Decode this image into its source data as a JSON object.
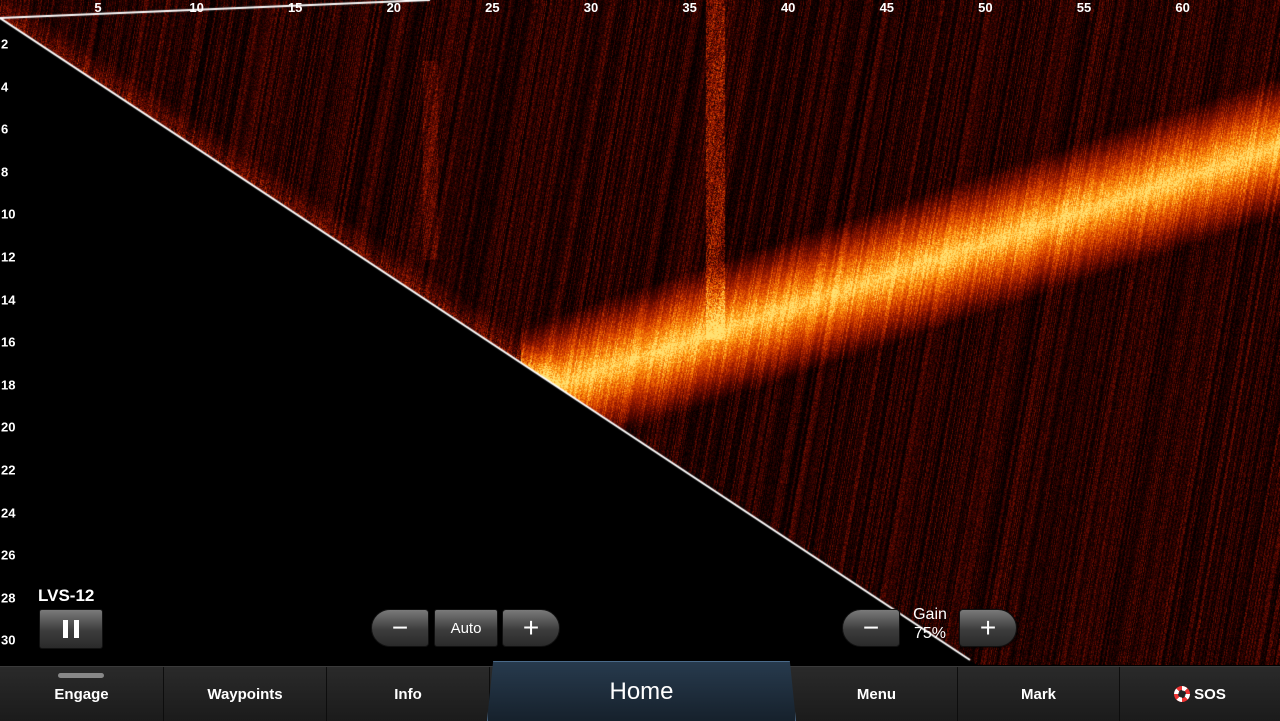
{
  "sonar": {
    "palette": [
      "#000000",
      "#4a0500",
      "#9a1a00",
      "#e04a00",
      "#ff9a10",
      "#ffe070"
    ],
    "range_ticks": [
      "5",
      "10",
      "15",
      "20",
      "25",
      "30",
      "35",
      "40",
      "45",
      "50",
      "55",
      "60"
    ],
    "depth_ticks": [
      "2",
      "4",
      "6",
      "8",
      "10",
      "12",
      "14",
      "16",
      "18",
      "20",
      "22",
      "24",
      "26",
      "28",
      "30"
    ]
  },
  "transducer": {
    "label": "LVS-12",
    "pause_icon": "pause-icon"
  },
  "range_control": {
    "minus": "−",
    "mode": "Auto",
    "plus": "+"
  },
  "gain_control": {
    "minus": "−",
    "label": "Gain",
    "value": "75%",
    "plus": "+"
  },
  "nav": {
    "engage": "Engage",
    "waypoints": "Waypoints",
    "info": "Info",
    "home": "Home",
    "menu": "Menu",
    "mark": "Mark",
    "sos": "SOS"
  }
}
